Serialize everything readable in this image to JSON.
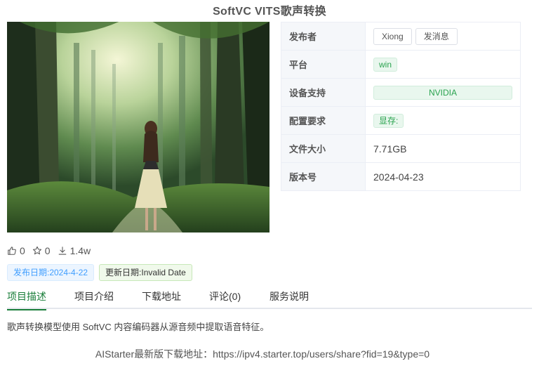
{
  "title": "SoftVC VITS歌声转换",
  "info": {
    "publisher_label": "发布者",
    "publisher_name": "Xiong",
    "message_button": "发消息",
    "platform_label": "平台",
    "platform_value": "win",
    "device_label": "设备支持",
    "device_value": "NVIDIA",
    "config_label": "配置要求",
    "config_value": "显存:",
    "size_label": "文件大小",
    "size_value": "7.71GB",
    "version_label": "版本号",
    "version_value": "2024-04-23"
  },
  "stats": {
    "likes": "0",
    "stars": "0",
    "downloads": "1.4w"
  },
  "dates": {
    "published": "发布日期:2024-4-22",
    "updated": "更新日期:Invalid Date"
  },
  "tabs": [
    {
      "label": "项目描述",
      "active": true
    },
    {
      "label": "项目介绍"
    },
    {
      "label": "下载地址"
    },
    {
      "label": "评论(0)"
    },
    {
      "label": "服务说明"
    }
  ],
  "description": "歌声转换模型使用 SoftVC 内容编码器从源音频中提取语音特征。",
  "download_line": "AIStarter最新版下载地址：https://ipv4.starter.top/users/share?fid=19&type=0",
  "colors": {
    "accent": "#1a7e3a",
    "tag_green": "#2aa34f",
    "tag_blue": "#409eff"
  },
  "icons": {
    "likes": "thumbs-up-icon",
    "stars": "star-icon",
    "downloads": "download-icon"
  }
}
